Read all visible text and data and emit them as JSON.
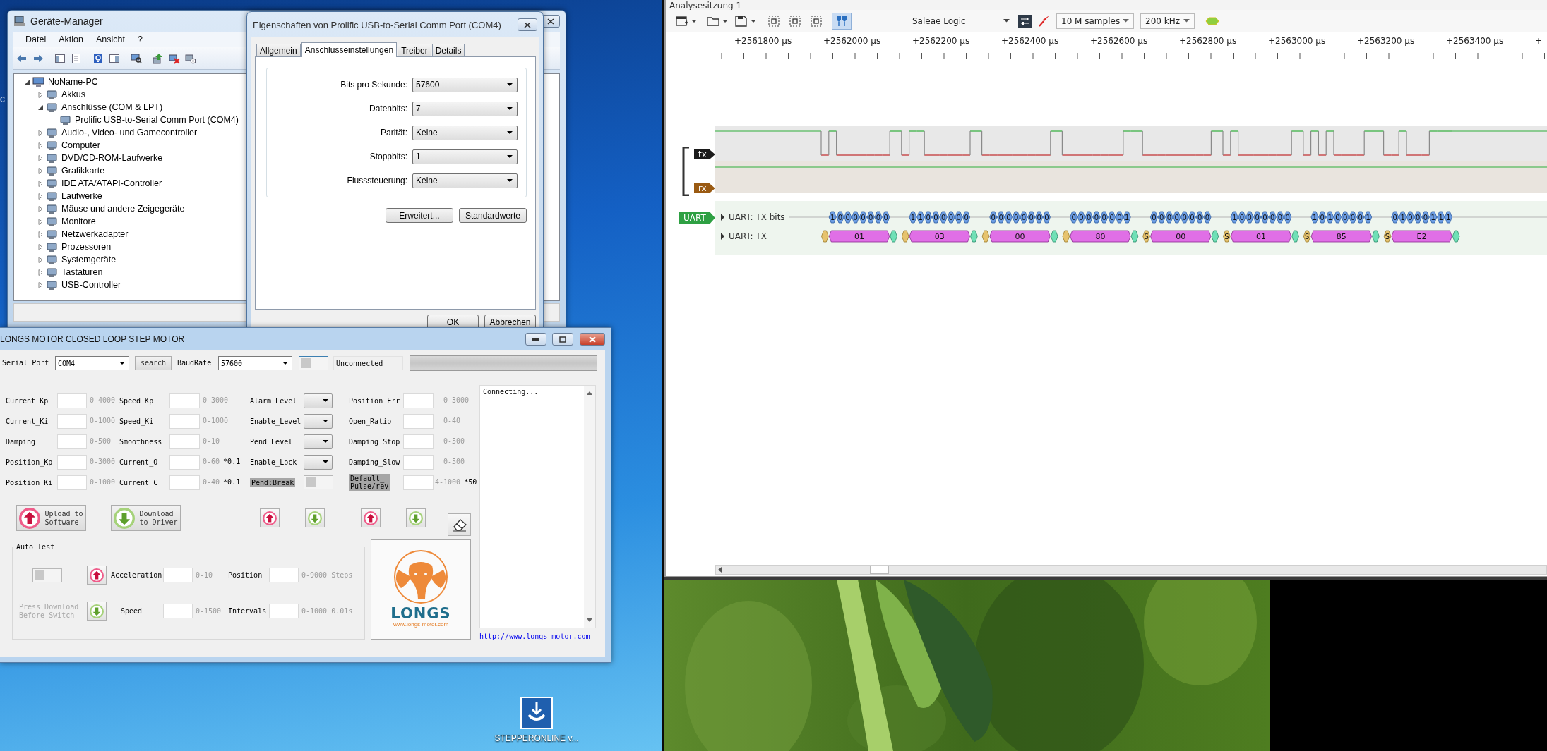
{
  "desktop": {
    "edge_text": "c",
    "shortcut_label": "STEPPERONLINE v..."
  },
  "device_manager": {
    "title": "Geräte-Manager",
    "menu": [
      "Datei",
      "Aktion",
      "Ansicht",
      "?"
    ],
    "tree": [
      {
        "label": "NoName-PC",
        "expanded": true,
        "children": [
          {
            "label": "Akkus",
            "expanded": false
          },
          {
            "label": "Anschlüsse (COM & LPT)",
            "expanded": true,
            "children": [
              {
                "label": "Prolific USB-to-Serial Comm Port (COM4)"
              }
            ]
          },
          {
            "label": "Audio-, Video- und Gamecontroller",
            "expanded": false
          },
          {
            "label": "Computer",
            "expanded": false
          },
          {
            "label": "DVD/CD-ROM-Laufwerke",
            "expanded": false
          },
          {
            "label": "Grafikkarte",
            "expanded": false
          },
          {
            "label": "IDE ATA/ATAPI-Controller",
            "expanded": false
          },
          {
            "label": "Laufwerke",
            "expanded": false
          },
          {
            "label": "Mäuse und andere Zeigegeräte",
            "expanded": false
          },
          {
            "label": "Monitore",
            "expanded": false
          },
          {
            "label": "Netzwerkadapter",
            "expanded": false
          },
          {
            "label": "Prozessoren",
            "expanded": false
          },
          {
            "label": "Systemgeräte",
            "expanded": false
          },
          {
            "label": "Tastaturen",
            "expanded": false
          },
          {
            "label": "USB-Controller",
            "expanded": false
          }
        ]
      }
    ]
  },
  "properties": {
    "title": "Eigenschaften von Prolific USB-to-Serial Comm Port (COM4)",
    "tabs": [
      {
        "label": "Allgemein",
        "selected": false
      },
      {
        "label": "Anschlusseinstellungen",
        "selected": true
      },
      {
        "label": "Treiber",
        "selected": false
      },
      {
        "label": "Details",
        "selected": false
      }
    ],
    "fields": [
      {
        "label": "Bits pro Sekunde:",
        "value": "57600"
      },
      {
        "label": "Datenbits:",
        "value": "7"
      },
      {
        "label": "Parität:",
        "value": "Keine"
      },
      {
        "label": "Stoppbits:",
        "value": "1"
      },
      {
        "label": "Flusssteuerung:",
        "value": "Keine"
      }
    ],
    "buttons": [
      "Erweitert...",
      "Standardwerte"
    ],
    "footer_buttons": [
      "OK",
      "Abbrechen"
    ]
  },
  "longs": {
    "title": "LONGS MOTOR CLOSED LOOP STEP MOTOR",
    "serial_port_label": "Serial Port",
    "serial_port": "COM4",
    "search": "search",
    "baud_label": "BaudRate",
    "baud": "57600",
    "connect_on": false,
    "status": "Unconnected",
    "progress": {
      "level": 0
    },
    "params": [
      {
        "kind": "input",
        "label": "Current_Kp",
        "range": "0-4000",
        "highlighted": false
      },
      {
        "kind": "input",
        "label": "Speed_Kp",
        "range": "0-3000",
        "highlighted": false
      },
      {
        "kind": "select",
        "label": "Alarm_Level",
        "highlighted": false
      },
      {
        "kind": "input",
        "label": "Position_Err",
        "range": "0-3000",
        "highlighted": false
      },
      {
        "kind": "input",
        "label": "Current_Ki",
        "range": "0-1000",
        "highlighted": false
      },
      {
        "kind": "input",
        "label": "Speed_Ki",
        "range": "0-1000",
        "highlighted": false
      },
      {
        "kind": "select",
        "label": "Enable_Level",
        "highlighted": false
      },
      {
        "kind": "input",
        "label": "Open_Ratio",
        "range": "0-40",
        "highlighted": false
      },
      {
        "kind": "input",
        "label": "Damping",
        "range": "0-500",
        "highlighted": false
      },
      {
        "kind": "input",
        "label": "Smoothness",
        "range": "0-10",
        "highlighted": false
      },
      {
        "kind": "select",
        "label": "Pend_Level",
        "highlighted": false
      },
      {
        "kind": "input",
        "label": "Damping_Stop",
        "range": "0-500",
        "highlighted": false
      },
      {
        "kind": "input",
        "label": "Position_Kp",
        "range": "0-3000",
        "highlighted": false
      },
      {
        "kind": "input",
        "label": "Current_O",
        "range": "0-60",
        "unit": "*0.1",
        "highlighted": false
      },
      {
        "kind": "select",
        "label": "Enable_Lock",
        "highlighted": false
      },
      {
        "kind": "input",
        "label": "Damping_Slow",
        "range": "0-500",
        "highlighted": false
      },
      {
        "kind": "input",
        "label": "Position_Ki",
        "range": "0-1000",
        "highlighted": false
      },
      {
        "kind": "input",
        "label": "Current_C",
        "range": "0-40",
        "unit": "*0.1",
        "highlighted": false
      },
      {
        "kind": "toggle",
        "label": "Pend:Break",
        "highlighted": true,
        "on": false
      },
      {
        "kind": "input",
        "label": "Default_\nPulse/rev",
        "range": "4-1000",
        "unit": "*50",
        "highlighted": true
      }
    ],
    "transfer_buttons": [
      {
        "kind": "upload",
        "label": "Upload to\nSoftware"
      },
      {
        "kind": "download",
        "label": "Download\nto Driver"
      }
    ],
    "auto_test": {
      "title": "Auto_Test",
      "toggle_on": false,
      "rows": [
        {
          "kind": "upload",
          "fields": [
            {
              "label": "Acceleration",
              "range": "0-10"
            },
            {
              "label": "Position",
              "range": "0-9000 Steps"
            }
          ]
        },
        {
          "note": "Press Download\nBefore  Switch",
          "kind": "download",
          "fields": [
            {
              "label": "Speed",
              "range": "0-1500"
            },
            {
              "label": "Intervals",
              "range": "0-1000 0.01s"
            }
          ]
        }
      ]
    },
    "logo": {
      "name": "LONGS",
      "url": "www.longs-motor.com"
    },
    "log": "Connecting...",
    "link": "http://www.longs-motor.com"
  },
  "saleae": {
    "title": "Analysesitzung 1",
    "device": "Saleae Logic",
    "samples": "10 M samples",
    "rate": "200 kHz",
    "time_labels": [
      "+2561800 µs",
      "+2562000 µs",
      "+2562200 µs",
      "+2562400 µs",
      "+2562600 µs",
      "+2562800 µs",
      "+2563000 µs",
      "+2563200 µs",
      "+2563400 µs",
      "+"
    ],
    "channels": [
      {
        "name": "tx",
        "color": "#1b1b1b"
      },
      {
        "name": "rx",
        "color": "#9a5a12"
      }
    ],
    "analyzer": {
      "tag": "UART",
      "rows": [
        "UART: TX bits",
        "UART: TX"
      ],
      "bytes": [
        {
          "value": "01",
          "bits": [
            "1",
            "0",
            "0",
            "0",
            "0",
            "0",
            "0",
            "0"
          ]
        },
        {
          "value": "03",
          "bits": [
            "1",
            "1",
            "0",
            "0",
            "0",
            "0",
            "0",
            "0"
          ]
        },
        {
          "value": "00",
          "bits": [
            "0",
            "0",
            "0",
            "0",
            "0",
            "0",
            "0",
            "0"
          ]
        },
        {
          "value": "80",
          "bits": [
            "0",
            "0",
            "0",
            "0",
            "0",
            "0",
            "0",
            "1"
          ]
        },
        {
          "value": "00",
          "start": "S",
          "bits": [
            "0",
            "0",
            "0",
            "0",
            "0",
            "0",
            "0",
            "0"
          ]
        },
        {
          "value": "01",
          "start": "S",
          "bits": [
            "1",
            "0",
            "0",
            "0",
            "0",
            "0",
            "0",
            "0"
          ]
        },
        {
          "value": "85",
          "start": "S",
          "bits": [
            "1",
            "0",
            "1",
            "0",
            "0",
            "0",
            "0",
            "1"
          ]
        },
        {
          "value": "E2",
          "start": "S",
          "bits": [
            "0",
            "1",
            "0",
            "0",
            "0",
            "1",
            "1",
            "1"
          ]
        }
      ]
    }
  }
}
